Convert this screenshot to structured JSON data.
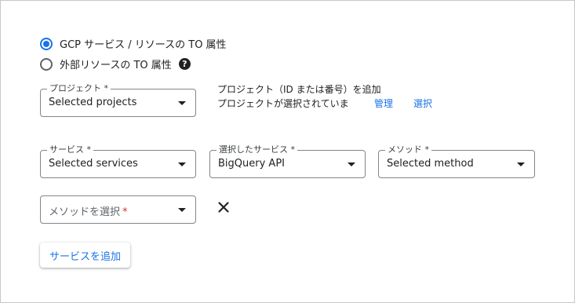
{
  "scope": {
    "options": [
      {
        "label": "GCP サービス / リソースの TO 属性",
        "selected": true
      },
      {
        "label": "外部リソースの TO 属性",
        "selected": false,
        "help_icon": "help-icon"
      }
    ]
  },
  "project": {
    "label": "プロジェクト *",
    "value": "Selected projects",
    "info_line1": "プロジェクト（ID または番号）を追加",
    "info_line2": "プロジェクトが選択されていま",
    "manage_link": "管理",
    "select_link": "選択"
  },
  "services": {
    "service_label": "サービス *",
    "service_value": "Selected services",
    "selected_service_label": "選択したサービス *",
    "selected_service_value": "BigQuery API",
    "method_label": "メソッド *",
    "method_value": "Selected method"
  },
  "method_select": {
    "placeholder": "メソッドを選択",
    "required_mark": "*",
    "remove_icon": "close-icon"
  },
  "add_service_button": "サービスを追加",
  "colors": {
    "accent": "#1a73e8",
    "required": "#d93025",
    "border": "#80868b"
  }
}
